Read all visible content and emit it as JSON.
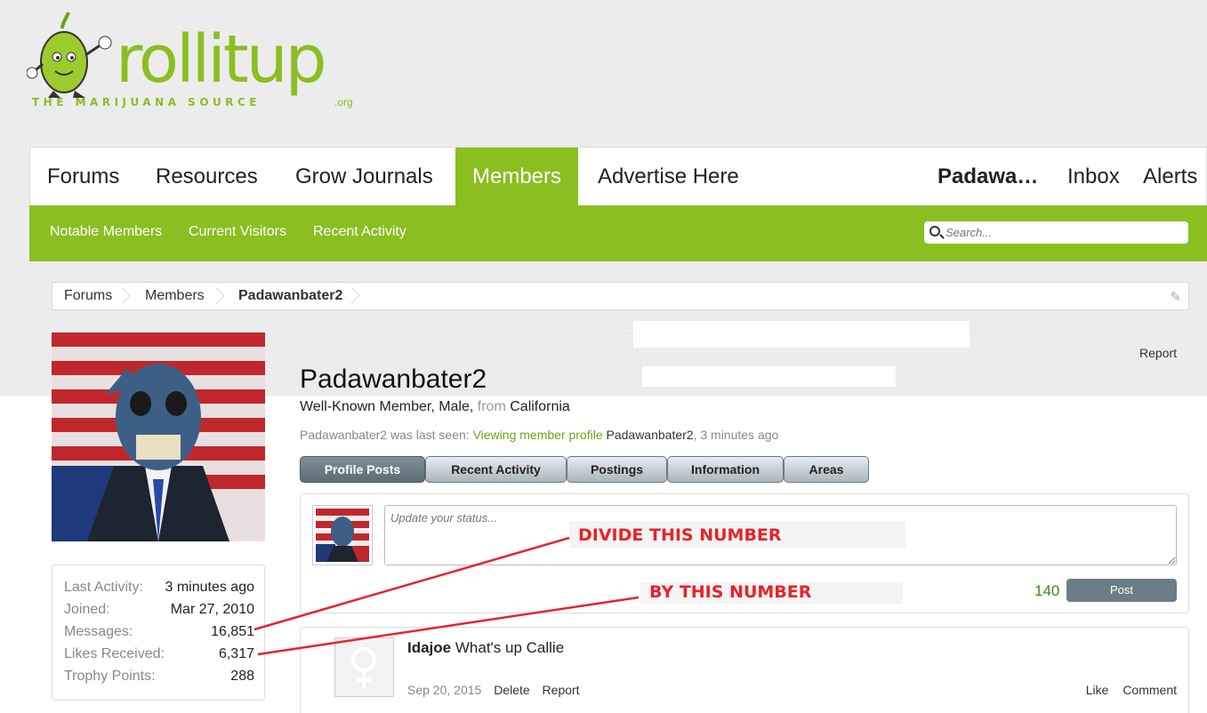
{
  "logo": {
    "word": "rollitup",
    "tagline": "THE MARIJUANA SOURCE",
    "tld": ".org"
  },
  "nav": {
    "tabs": [
      "Forums",
      "Resources",
      "Grow Journals",
      "Members",
      "Advertise Here"
    ],
    "active_tab": "Members",
    "user": "Padawa…",
    "inbox": "Inbox",
    "alerts": "Alerts"
  },
  "subnav": {
    "links": [
      "Notable Members",
      "Current Visitors",
      "Recent Activity"
    ]
  },
  "search": {
    "placeholder": "Search..."
  },
  "breadcrumb": {
    "items": [
      "Forums",
      "Members",
      "Padawanbater2"
    ]
  },
  "profile": {
    "username": "Padawanbater2",
    "title": "Well-Known Member, Male,",
    "from_label": "from",
    "location": "California",
    "last_seen_prefix": "Padawanbater2 was last seen:",
    "last_seen_link": "Viewing member profile",
    "last_seen_target": "Padawanbater2",
    "last_seen_time": ", 3 minutes ago",
    "report": "Report"
  },
  "stats": [
    {
      "label": "Last Activity:",
      "value": "3 minutes ago"
    },
    {
      "label": "Joined:",
      "value": "Mar 27, 2010"
    },
    {
      "label": "Messages:",
      "value": "16,851"
    },
    {
      "label": "Likes Received:",
      "value": "6,317"
    },
    {
      "label": "Trophy Points:",
      "value": "288"
    }
  ],
  "profile_tabs": [
    "Profile Posts",
    "Recent Activity",
    "Postings",
    "Information",
    "Areas"
  ],
  "status": {
    "placeholder": "Update your status...",
    "counter": "140",
    "post_button": "Post"
  },
  "comment": {
    "author": "Idajoe",
    "text": "What's up Callie",
    "date": "Sep 20, 2015",
    "delete": "Delete",
    "report": "Report",
    "like": "Like",
    "comment": "Comment"
  },
  "annotations": {
    "first": "DIVIDE THIS NUMBER",
    "second": "BY THIS NUMBER",
    "color": "#e8232a"
  },
  "colors": {
    "brand_green": "#8bbe21",
    "tab_active": "#5b6c76"
  }
}
